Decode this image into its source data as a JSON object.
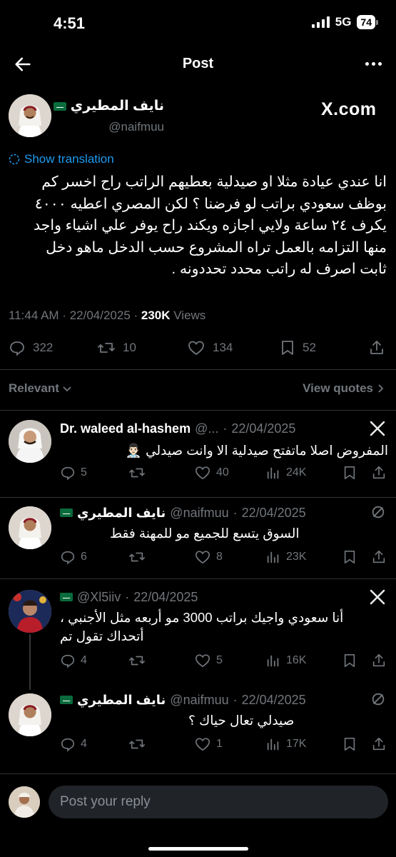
{
  "status_bar": {
    "time": "4:51",
    "network": "5G",
    "battery": "74"
  },
  "header": {
    "title": "Post"
  },
  "post": {
    "author_name": "نايف المطيري",
    "handle": "@naifmuu",
    "badge": "X.com",
    "translate": "Show translation",
    "body_lines": [
      "انا عندي عيادة مثلا  او صيدلية بعطيهم الراتب راح اخسر كم",
      "بوظف سعودي براتب لو فرضنا ؟ لكن المصري اعطيه ٤٠٠٠",
      "يكرف ٢٤ ساعة ولايي اجازه ويكند راح يوفر علي اشياء واجد",
      "منها التزامه بالعمل تراه المشروع حسب الدخل ماهو دخل",
      "ثابت اصرف له راتب محدد تحددونه ."
    ],
    "time": "11:44 AM",
    "date": "22/04/2025",
    "views_count": "230K",
    "views_label": "Views",
    "stats": {
      "replies": "322",
      "reposts": "10",
      "likes": "134",
      "bookmarks": "52"
    }
  },
  "sort": {
    "label": "Relevant",
    "view_quotes": "View quotes"
  },
  "replies": [
    {
      "name": "Dr. waleed al-hashem",
      "handle": "@...",
      "date": "22/04/2025",
      "lines": [
        "المفروض اصلا ماتفتح صيدلية الا وانت صيدلي 👨🏻‍⚕️"
      ],
      "stats": {
        "replies": "5",
        "reposts": "",
        "likes": "40",
        "views": "24K"
      }
    },
    {
      "name": "نايف المطيري",
      "handle": "@naifmuu",
      "date": "22/04/2025",
      "lines": [
        " السوق يتسع للجميع مو للمهنة فقط"
      ],
      "stats": {
        "replies": "6",
        "reposts": "",
        "likes": "8",
        "views": "23K"
      }
    },
    {
      "name": "",
      "handle": "@Xl5iiv",
      "date": "22/04/2025",
      "lines": [
        "أنا سعودي واجيك براتب 3000 مو أربعه مثل الأجنبي ،",
        "أتحداك تقول تم"
      ],
      "stats": {
        "replies": "4",
        "reposts": "",
        "likes": "5",
        "views": "16K"
      }
    },
    {
      "name": "نايف المطيري",
      "handle": "@naifmuu",
      "date": "22/04/2025",
      "lines": [
        "صيدلي تعال حياك ؟"
      ],
      "stats": {
        "replies": "4",
        "reposts": "",
        "likes": "1",
        "views": "17K"
      }
    }
  ],
  "compose": {
    "placeholder": "Post your reply"
  },
  "colors": {
    "background": "#000000",
    "text": "#e7e9ea",
    "muted": "#71767b",
    "link": "#1d9bf0",
    "divider": "#2f3336"
  }
}
